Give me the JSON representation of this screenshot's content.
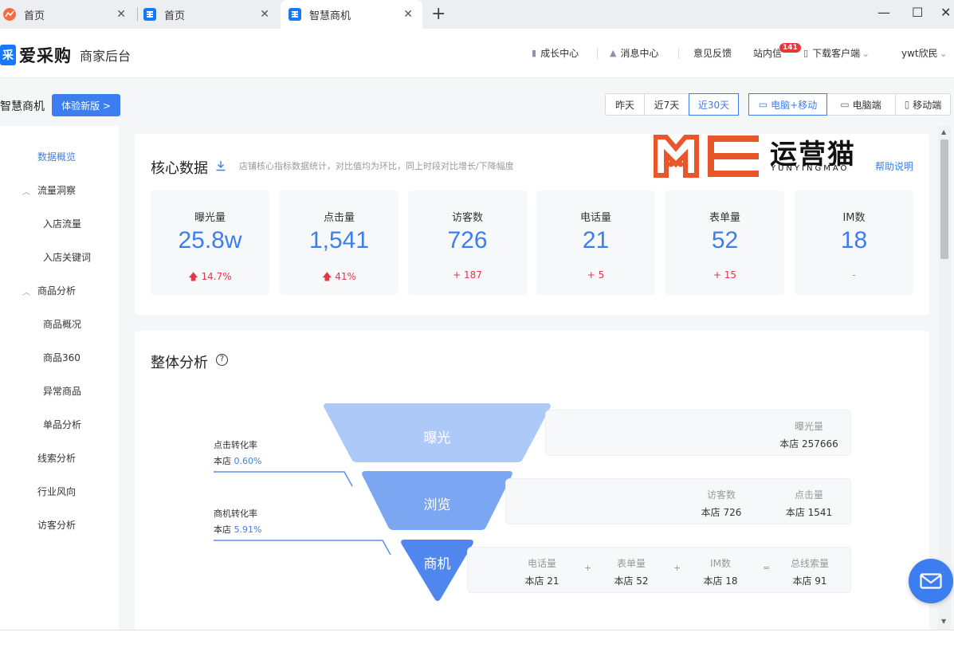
{
  "browser": {
    "tabs": [
      {
        "label": "首页",
        "favicon": "orange-chart-icon"
      },
      {
        "label": "首页",
        "favicon": "blue-app-icon"
      },
      {
        "label": "智慧商机",
        "favicon": "blue-app-icon",
        "active": true
      }
    ],
    "new_tab": "+",
    "window_controls": {
      "minimize": "—",
      "maximize": "☐",
      "close": "✕"
    }
  },
  "app": {
    "logo_mark": "采",
    "logo_name": "爱采购",
    "logo_sub": "商家后台",
    "nav": {
      "growth": "成长中心",
      "messages": "消息中心",
      "feedback": "意见反馈",
      "inbox": "站内信",
      "inbox_count": "141",
      "download": "下载客户端",
      "user": "ywt欣民"
    }
  },
  "subheader": {
    "title": "智慧商机",
    "try_new": "体验新版 >",
    "date_range": {
      "options": [
        "昨天",
        "近7天",
        "近30天"
      ],
      "selected": "近30天"
    },
    "device": {
      "options": [
        "电脑+移动",
        "电脑端",
        "移动端"
      ],
      "selected": "电脑+移动"
    }
  },
  "sidebar": {
    "items": [
      {
        "label": "数据概览",
        "active": true
      },
      {
        "label": "流量洞察",
        "group": true
      },
      {
        "label": "入店流量"
      },
      {
        "label": "入店关键词"
      },
      {
        "label": "商品分析",
        "group": true
      },
      {
        "label": "商品概况"
      },
      {
        "label": "商品360"
      },
      {
        "label": "异常商品"
      },
      {
        "label": "单品分析"
      },
      {
        "label": "线索分析"
      },
      {
        "label": "行业风向"
      },
      {
        "label": "访客分析"
      }
    ]
  },
  "core": {
    "title": "核心数据",
    "desc": "店铺核心指标数据统计，对比值均为环比，同上时段对比增长/下降幅度",
    "watermark_cn": "运营猫",
    "watermark_en": "YUNYINGMAO",
    "help": "帮助说明",
    "metrics": [
      {
        "label": "曝光量",
        "value": "25.8w",
        "change": "14.7%",
        "arrow": "up"
      },
      {
        "label": "点击量",
        "value": "1,541",
        "change": "41%",
        "arrow": "up"
      },
      {
        "label": "访客数",
        "value": "726",
        "change": "+ 187"
      },
      {
        "label": "电话量",
        "value": "21",
        "change": "+ 5"
      },
      {
        "label": "表单量",
        "value": "52",
        "change": "+ 15"
      },
      {
        "label": "IM数",
        "value": "18",
        "change": "-"
      }
    ]
  },
  "overall": {
    "title": "整体分析",
    "funnel": {
      "stages": [
        "曝光",
        "浏览",
        "商机"
      ],
      "exposure": {
        "label": "曝光量",
        "value": "本店 257666"
      },
      "browse": [
        {
          "label": "访客数",
          "value": "本店 726"
        },
        {
          "label": "点击量",
          "value": "本店 1541"
        }
      ],
      "opportunity": [
        {
          "label": "电话量",
          "value": "本店 21"
        },
        {
          "label": "表单量",
          "value": "本店 52"
        },
        {
          "label": "IM数",
          "value": "本店 18"
        },
        {
          "label": "总线索量",
          "value": "本店 91"
        }
      ],
      "operators": [
        "+",
        "+",
        "="
      ]
    },
    "conversions": [
      {
        "label": "点击转化率",
        "prefix": "本店",
        "value": "0.60%"
      },
      {
        "label": "商机转化率",
        "prefix": "本店",
        "value": "5.91%"
      }
    ]
  },
  "colors": {
    "accent": "#3c7ef0",
    "up": "#e0384a",
    "funnel_top": "#adc9f8",
    "funnel_mid": "#7aa6f2",
    "funnel_bottom": "#4f87ef"
  }
}
